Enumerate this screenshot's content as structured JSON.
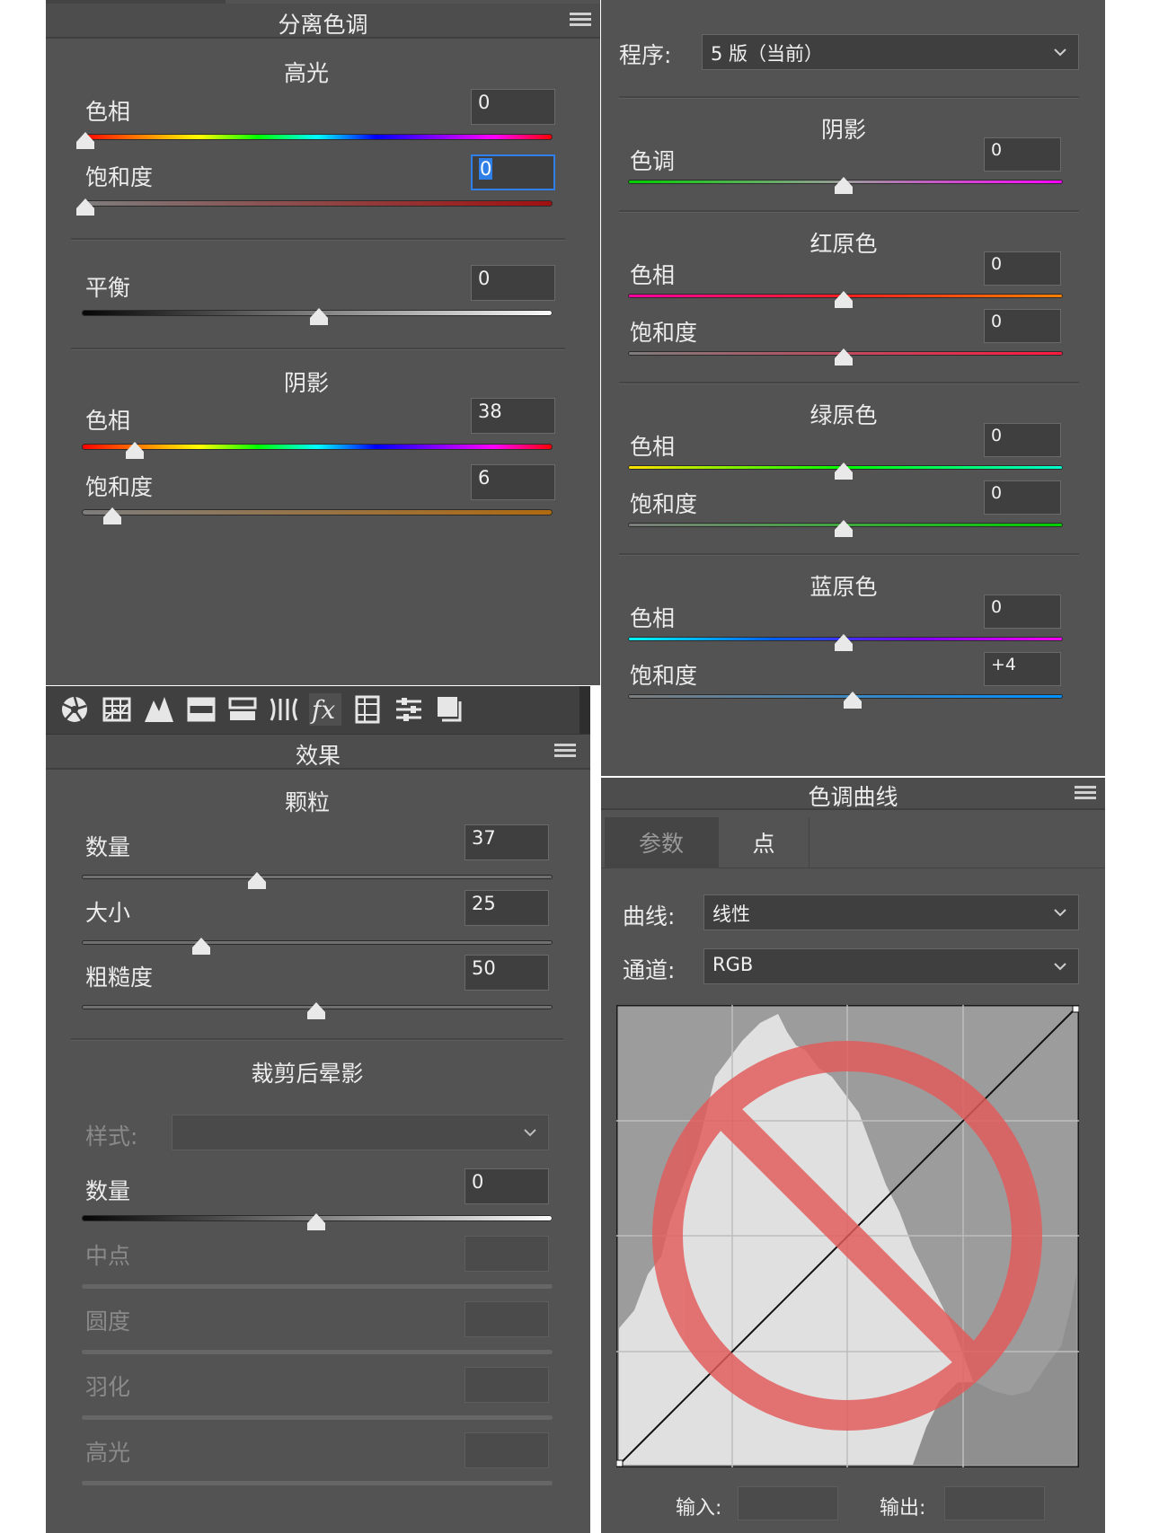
{
  "split_toning": {
    "title": "分离色调",
    "highlights": {
      "heading": "高光",
      "hue_label": "色相",
      "hue_value": "0",
      "saturation_label": "饱和度",
      "saturation_value": "0"
    },
    "balance": {
      "label": "平衡",
      "value": "0"
    },
    "shadows": {
      "heading": "阴影",
      "hue_label": "色相",
      "hue_value": "38",
      "saturation_label": "饱和度",
      "saturation_value": "6"
    }
  },
  "calibration": {
    "process_label": "程序:",
    "process_value": "5 版（当前）",
    "shadows": {
      "heading": "阴影",
      "tint_label": "色调",
      "tint_value": "0"
    },
    "red": {
      "heading": "红原色",
      "hue_label": "色相",
      "hue_value": "0",
      "saturation_label": "饱和度",
      "saturation_value": "0"
    },
    "green": {
      "heading": "绿原色",
      "hue_label": "色相",
      "hue_value": "0",
      "saturation_label": "饱和度",
      "saturation_value": "0"
    },
    "blue": {
      "heading": "蓝原色",
      "hue_label": "色相",
      "hue_value": "0",
      "saturation_label": "饱和度",
      "saturation_value": "+4"
    }
  },
  "effects": {
    "toolbar_icons": [
      "aperture-icon",
      "grid-icon",
      "mountain-icon",
      "split-icon",
      "two-bars-icon",
      "lens-icon",
      "fx-icon",
      "film-icon",
      "sliders-icon",
      "presets-icon"
    ],
    "title": "效果",
    "grain": {
      "heading": "颗粒",
      "amount_label": "数量",
      "amount_value": "37",
      "size_label": "大小",
      "size_value": "25",
      "roughness_label": "粗糙度",
      "roughness_value": "50"
    },
    "vignette": {
      "heading": "裁剪后晕影",
      "style_label": "样式:",
      "amount_label": "数量",
      "amount_value": "0",
      "midpoint_label": "中点",
      "roundness_label": "圆度",
      "feather_label": "羽化",
      "highlights_label": "高光"
    }
  },
  "tone_curve": {
    "title": "色调曲线",
    "tabs": [
      "参数",
      "点"
    ],
    "active_tab": "点",
    "curve_label": "曲线:",
    "curve_value": "线性",
    "channel_label": "通道:",
    "channel_value": "RGB",
    "input_label": "输入:",
    "output_label": "输出:",
    "overlay_color": "#e35b5b"
  }
}
